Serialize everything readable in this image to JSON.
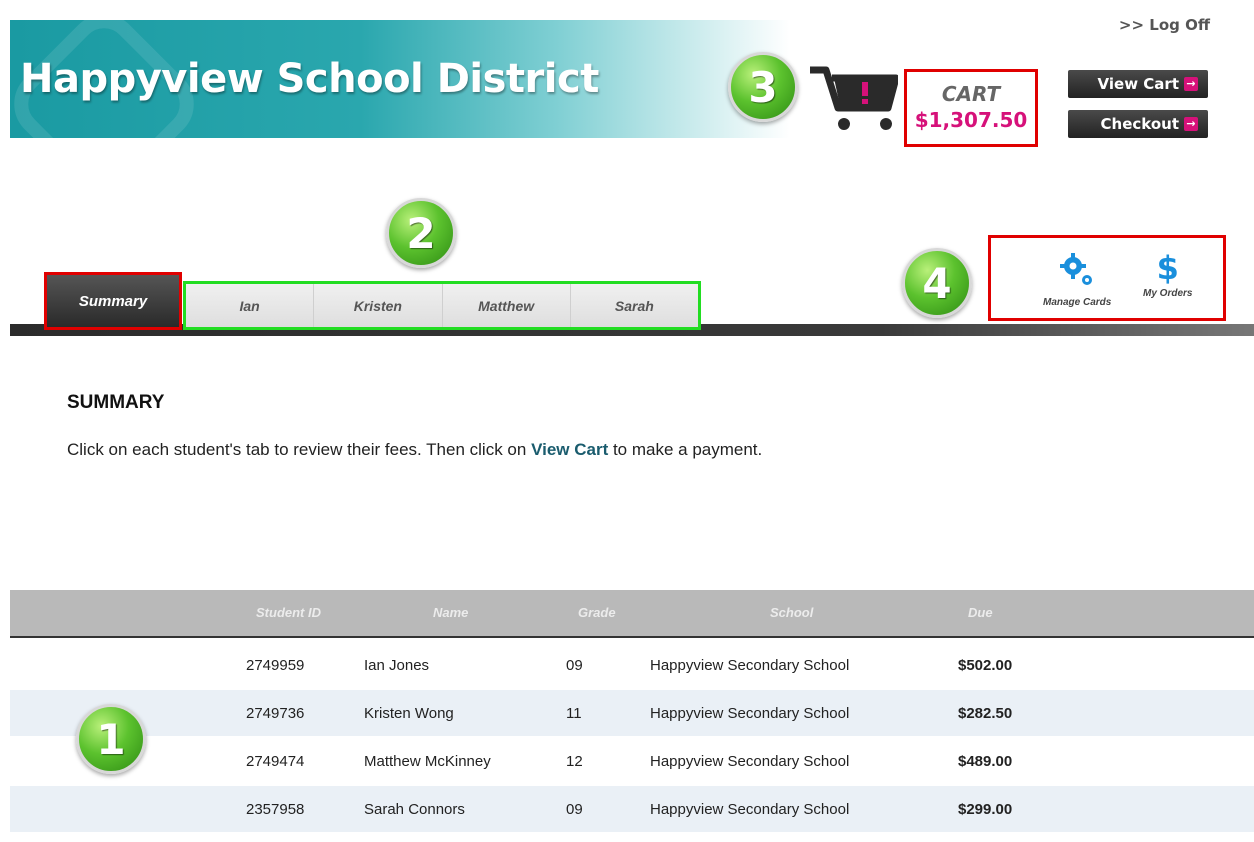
{
  "header": {
    "title": "Happyview School District",
    "logoff": ">> Log Off"
  },
  "badges": {
    "b1": "1",
    "b2": "2",
    "b3": "3",
    "b4": "4"
  },
  "cart": {
    "label": "CART",
    "amount": "$1,307.50",
    "view_cart": "View Cart",
    "checkout": "Checkout",
    "arrow": "→"
  },
  "tabs": {
    "summary": "Summary",
    "students": [
      "Ian",
      "Kristen",
      "Matthew",
      "Sarah"
    ]
  },
  "tools": {
    "manage_cards": "Manage Cards",
    "my_orders": "My Orders",
    "dollar": "$"
  },
  "summary": {
    "heading": "SUMMARY",
    "instr_before": "Click on each student's tab to review their fees. Then click on ",
    "instr_link": "View Cart",
    "instr_after": " to make a payment."
  },
  "table": {
    "headers": {
      "id": "Student ID",
      "name": "Name",
      "grade": "Grade",
      "school": "School",
      "due": "Due"
    },
    "rows": [
      {
        "id": "2749959",
        "name": "Ian Jones",
        "grade": "09",
        "school": "Happyview Secondary School",
        "due": "$502.00"
      },
      {
        "id": "2749736",
        "name": "Kristen Wong",
        "grade": "11",
        "school": "Happyview Secondary School",
        "due": "$282.50"
      },
      {
        "id": "2749474",
        "name": "Matthew McKinney",
        "grade": "12",
        "school": "Happyview Secondary School",
        "due": "$489.00"
      },
      {
        "id": "2357958",
        "name": "Sarah Connors",
        "grade": "09",
        "school": "Happyview Secondary School",
        "due": "$299.00"
      }
    ]
  },
  "colors": {
    "accent_pink": "#d6117a",
    "teal": "#1a9aa2",
    "highlight_red": "#e00000",
    "highlight_green": "#22dd22"
  }
}
